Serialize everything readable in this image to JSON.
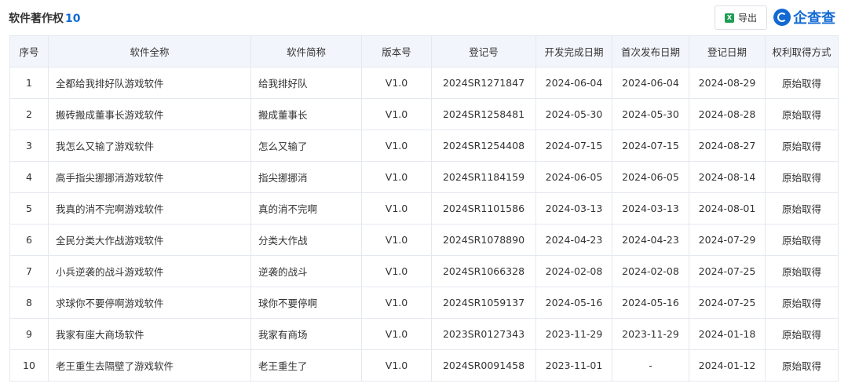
{
  "header": {
    "title": "软件著作权",
    "count": "10",
    "export_label": "导出",
    "brand_name": "企查查"
  },
  "colors": {
    "accent": "#1269d3",
    "header_bg": "#f2f6fc",
    "border": "#e4e8ef",
    "excel_green": "#1f9d55"
  },
  "table": {
    "columns": [
      "序号",
      "软件全称",
      "软件简称",
      "版本号",
      "登记号",
      "开发完成日期",
      "首次发布日期",
      "登记日期",
      "权利取得方式"
    ],
    "rows": [
      [
        "1",
        "全都给我排好队游戏软件",
        "给我排好队",
        "V1.0",
        "2024SR1271847",
        "2024-06-04",
        "2024-06-04",
        "2024-08-29",
        "原始取得"
      ],
      [
        "2",
        "搬砖搬成董事长游戏软件",
        "搬成董事长",
        "V1.0",
        "2024SR1258481",
        "2024-05-30",
        "2024-05-30",
        "2024-08-28",
        "原始取得"
      ],
      [
        "3",
        "我怎么又输了游戏软件",
        "怎么又输了",
        "V1.0",
        "2024SR1254408",
        "2024-07-15",
        "2024-07-15",
        "2024-08-27",
        "原始取得"
      ],
      [
        "4",
        "高手指尖挪挪消游戏软件",
        "指尖挪挪消",
        "V1.0",
        "2024SR1184159",
        "2024-06-05",
        "2024-06-05",
        "2024-08-14",
        "原始取得"
      ],
      [
        "5",
        "我真的消不完啊游戏软件",
        "真的消不完啊",
        "V1.0",
        "2024SR1101586",
        "2024-03-13",
        "2024-03-13",
        "2024-08-01",
        "原始取得"
      ],
      [
        "6",
        "全民分类大作战游戏软件",
        "分类大作战",
        "V1.0",
        "2024SR1078890",
        "2024-04-23",
        "2024-04-23",
        "2024-07-29",
        "原始取得"
      ],
      [
        "7",
        "小兵逆袭的战斗游戏软件",
        "逆袭的战斗",
        "V1.0",
        "2024SR1066328",
        "2024-02-08",
        "2024-02-08",
        "2024-07-25",
        "原始取得"
      ],
      [
        "8",
        "求球你不要停啊游戏软件",
        "球你不要停啊",
        "V1.0",
        "2024SR1059137",
        "2024-05-16",
        "2024-05-16",
        "2024-07-25",
        "原始取得"
      ],
      [
        "9",
        "我家有座大商场软件",
        "我家有商场",
        "V1.0",
        "2023SR0127343",
        "2023-11-29",
        "2023-11-29",
        "2024-01-18",
        "原始取得"
      ],
      [
        "10",
        "老王重生去隔壁了游戏软件",
        "老王重生了",
        "V1.0",
        "2024SR0091458",
        "2023-11-01",
        "-",
        "2024-01-12",
        "原始取得"
      ]
    ]
  }
}
